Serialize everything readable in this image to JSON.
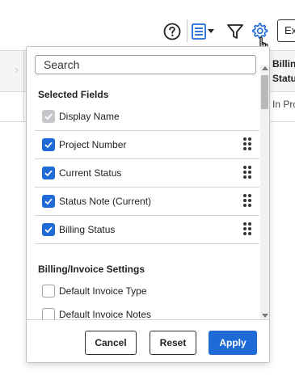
{
  "toolbar": {
    "export_label": "Ex",
    "icons": [
      "help-icon",
      "columns-list-icon",
      "filter-icon",
      "settings-icon",
      "hand-cursor-icon"
    ],
    "accent_color": "#1e6ad6"
  },
  "background_table": {
    "column_header": "Billin\nStatu",
    "cell_value": "In Pro"
  },
  "column_picker": {
    "search": {
      "placeholder": "Search",
      "value": ""
    },
    "selected_section_title": "Selected Fields",
    "selected_fields": [
      {
        "label": "Display Name",
        "checked": true,
        "locked": true
      },
      {
        "label": "Project Number",
        "checked": true,
        "locked": false
      },
      {
        "label": "Current Status",
        "checked": true,
        "locked": false
      },
      {
        "label": "Status Note (Current)",
        "checked": true,
        "locked": false
      },
      {
        "label": "Billing Status",
        "checked": true,
        "locked": false
      }
    ],
    "billing_section_title": "Billing/Invoice Settings",
    "billing_fields": [
      {
        "label": "Default Invoice Type",
        "checked": false
      },
      {
        "label": "Default Invoice Notes",
        "checked": false
      }
    ],
    "buttons": {
      "cancel": "Cancel",
      "reset": "Reset",
      "apply": "Apply"
    }
  }
}
